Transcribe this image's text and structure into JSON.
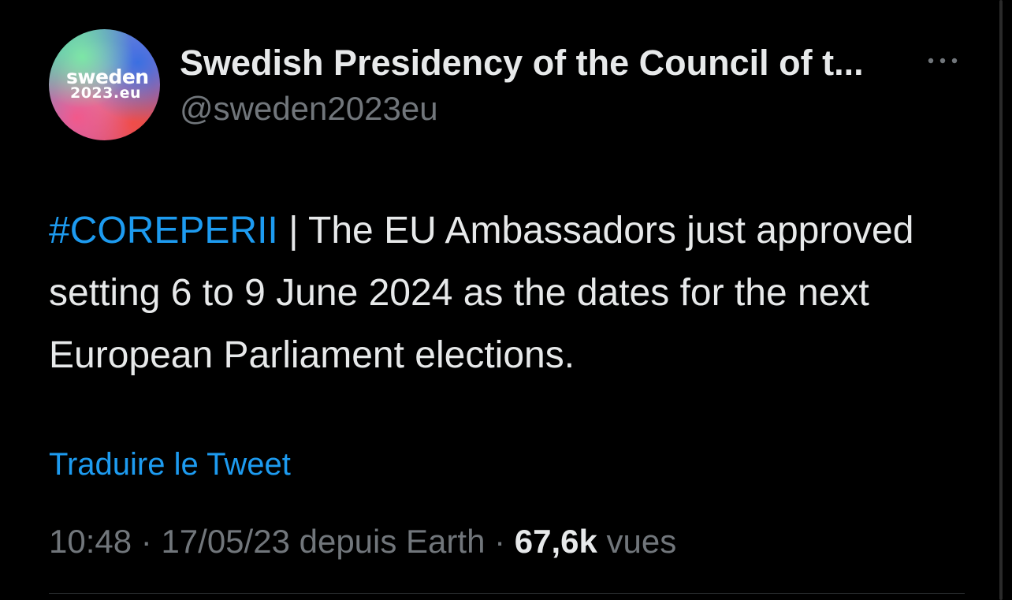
{
  "author": {
    "avatar_line1": "sweden",
    "avatar_line2": "2023.eu",
    "display_name": "Swedish Presidency of the Council of t...",
    "handle": "@sweden2023eu"
  },
  "tweet": {
    "hashtag": "#COREPERII",
    "body": " | The EU Ambassadors just approved setting 6 to 9 June 2024 as the dates for the next European Parliament elections."
  },
  "translate_label": "Traduire le Tweet",
  "meta": {
    "time": "10:48",
    "separator": " · ",
    "date": "17/05/23",
    "source": " depuis Earth",
    "views_count": "67,6k",
    "views_label": " vues"
  },
  "icons": {
    "more": "more-horizontal-icon"
  },
  "colors": {
    "background": "#000000",
    "text": "#e7e9ea",
    "secondary": "#71767b",
    "accent": "#1d9bf0"
  }
}
